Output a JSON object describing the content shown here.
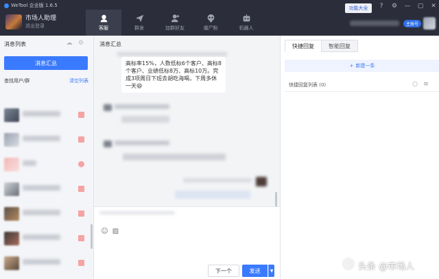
{
  "app": {
    "title": "WeTool 企业版 1.6.5",
    "feature_button": "功能大全",
    "user_name": "市场人助理",
    "logout": "退出登录",
    "account_badge": "主账号"
  },
  "nav_tabs": [
    {
      "label": "客服",
      "icon": "headset-icon",
      "active": true
    },
    {
      "label": "群发",
      "icon": "send-icon",
      "active": false
    },
    {
      "label": "加群好友",
      "icon": "add-friend-icon",
      "active": false
    },
    {
      "label": "僵尸粉",
      "icon": "skull-icon",
      "active": false
    },
    {
      "label": "机器人",
      "icon": "robot-icon",
      "active": false
    }
  ],
  "left_panel": {
    "header": "消息列表",
    "summary_button": "消息汇总",
    "search_placeholder": "查找用户/群",
    "clear_list": "清空列表"
  },
  "chat": {
    "title": "消息汇总",
    "message_text": "高标率15%，人数低标6个客户、高标8个客户、业绩低标8万、高标10万。完成3项周日下班去胡吃海喝，下周多休一天",
    "emoji": "😆",
    "next_button": "下一个",
    "send_button": "发送"
  },
  "right_panel": {
    "tabs": [
      {
        "label": "快捷回复",
        "active": true
      },
      {
        "label": "智能回复",
        "active": false
      }
    ],
    "new_reply": "新建一条",
    "reply_list_label": "快捷回复列表 (0)"
  },
  "watermark": {
    "text": "头条 @市场人",
    "logo_text": "市场人"
  },
  "colors": {
    "topbar": "#2b2d3a",
    "accent": "#3a7afe"
  }
}
